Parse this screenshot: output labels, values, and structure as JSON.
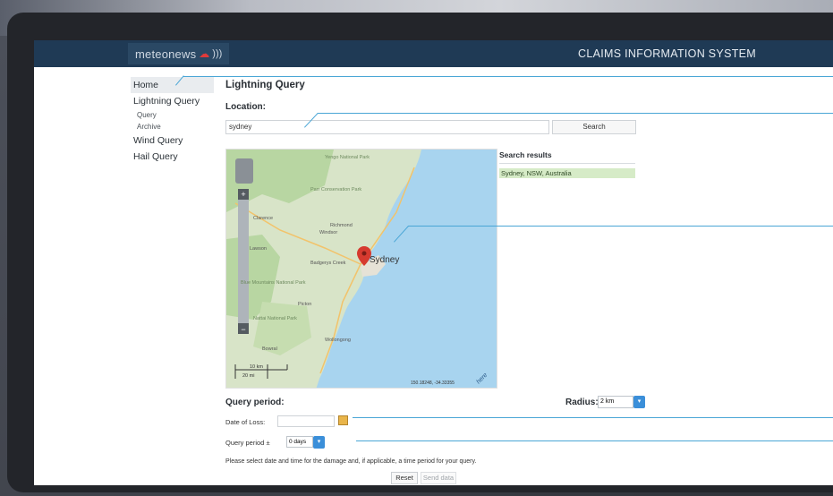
{
  "header": {
    "logo_text": "meteonews",
    "logo_cloud": "☁",
    "logo_waves": ")))",
    "app_title": "CLAIMS INFORMATION SYSTEM"
  },
  "sidebar": {
    "items": [
      {
        "label": "Home"
      },
      {
        "label": "Lightning Query"
      },
      {
        "label": "Query"
      },
      {
        "label": "Archive"
      },
      {
        "label": "Wind Query"
      },
      {
        "label": "Hail Query"
      }
    ]
  },
  "main": {
    "title": "Lightning Query",
    "location_label": "Location:",
    "location_value": "sydney",
    "search_label": "Search",
    "results_title": "Search results",
    "results": [
      "Sydney, NSW, Australia"
    ],
    "period_title": "Query period:",
    "radius_label": "Radius:",
    "radius_value": "2 km",
    "date_label": "Date of Loss:",
    "query_period_label": "Query period ±",
    "query_period_value": "0 days",
    "note": "Please select date and time for the damage and, if applicable, a time period for your query.",
    "reset_label": "Reset",
    "send_label": "Send data"
  },
  "map": {
    "city": "Sydney",
    "places": [
      "Yengo National Park",
      "Parr Conservation Park",
      "Clarence",
      "Lawson",
      "Windsor",
      "Richmond",
      "Badgerys Creek",
      "Blue Mountains National Park",
      "Picton",
      "Nattai National Park",
      "Wollongong",
      "Bowral"
    ],
    "scale_km": "10 km",
    "scale_mi": "20 mi",
    "coords": "150.18248, -34.33355",
    "brand": "here"
  },
  "colors": {
    "topbar": "#1f3a55",
    "accent_blue": "#3b8fd9",
    "callout": "#4aa6d6",
    "result_bg": "#d6ebc7",
    "water": "#a8d4ef",
    "land": "#d8e4c8",
    "forest": "#b8d6a2",
    "pin": "#d63a2f"
  }
}
